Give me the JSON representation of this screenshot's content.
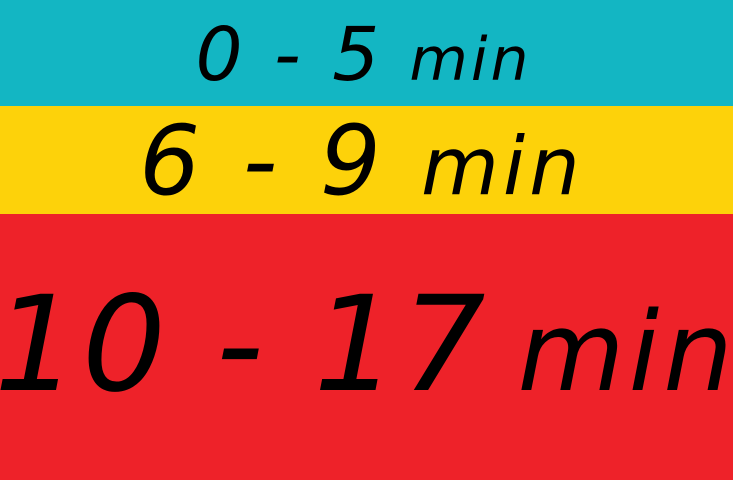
{
  "legend": {
    "bands": [
      {
        "range": "0 - 5",
        "unit": "min",
        "color": "#13B6C3"
      },
      {
        "range": "6 - 9",
        "unit": "min",
        "color": "#FDD20A"
      },
      {
        "range": "10 - 17",
        "unit": "min",
        "color": "#EE2229"
      }
    ]
  }
}
